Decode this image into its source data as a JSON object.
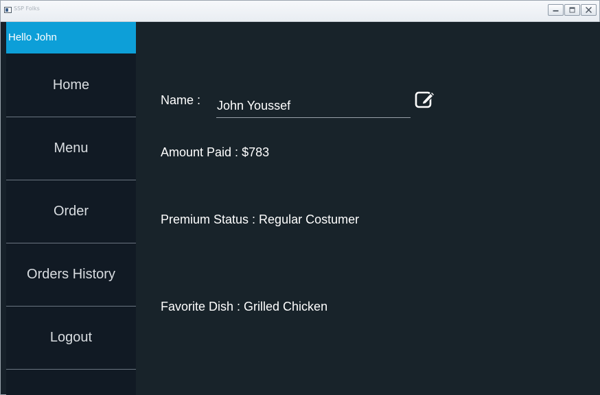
{
  "window": {
    "title": "SSP Folks",
    "icon": "app-window-icon",
    "controls": [
      "minimize-icon",
      "maximize-icon",
      "close-icon"
    ]
  },
  "sidebar": {
    "greeting": "Hello John",
    "items": [
      {
        "label": "Home"
      },
      {
        "label": "Menu"
      },
      {
        "label": "Order"
      },
      {
        "label": "Orders History"
      },
      {
        "label": "Logout"
      }
    ]
  },
  "profile": {
    "name_label": "Name :",
    "name_value": "John Youssef",
    "edit_icon": "edit-icon",
    "amount_paid": "Amount Paid : $783",
    "premium_status": "Premium Status : Regular Costumer",
    "favorite_dish": "Favorite Dish : Grilled Chicken"
  },
  "colors": {
    "greeting_bg": "#0d9fd8",
    "sidebar_bg": "#111a24",
    "content_bg": "#18232a"
  }
}
